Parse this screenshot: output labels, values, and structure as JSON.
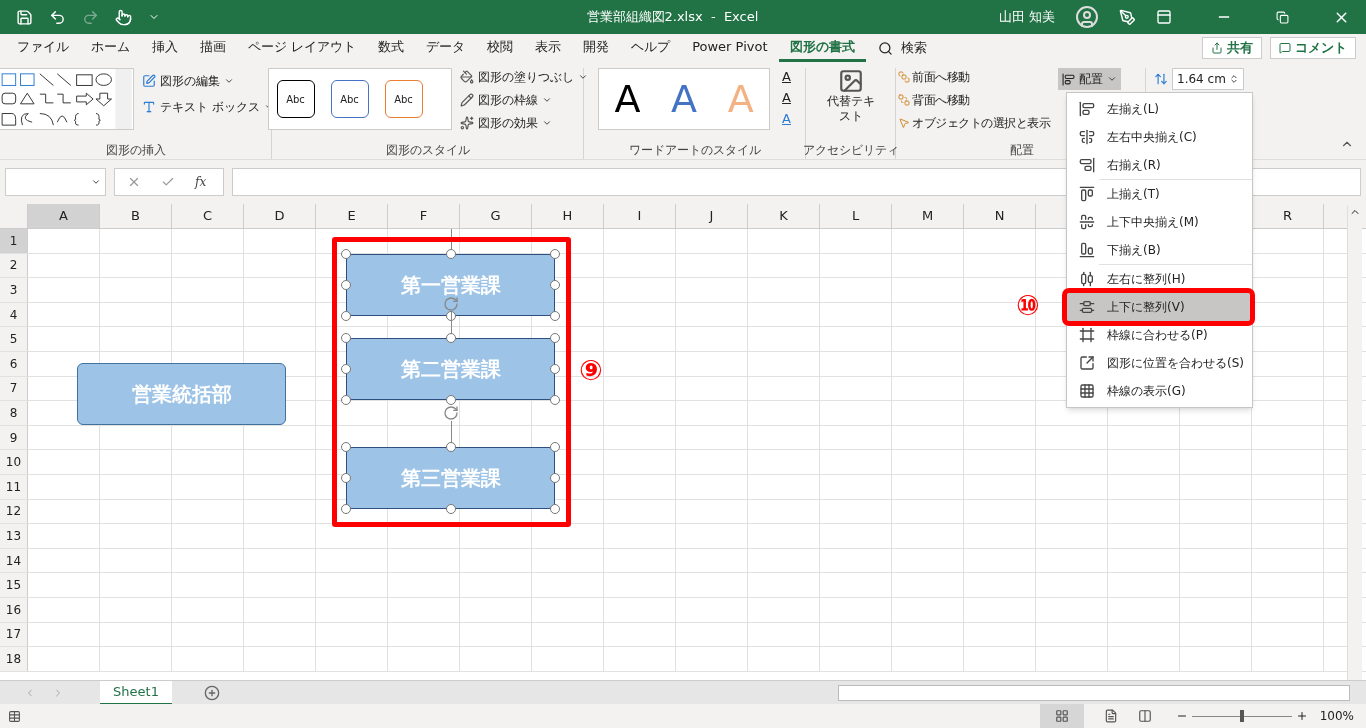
{
  "title_bar": {
    "file_title": "営業部組織図2.xlsx  -  Excel",
    "user_name": "山田 知美"
  },
  "ribbon_tabs": [
    {
      "label": "ファイル",
      "selected": false
    },
    {
      "label": "ホーム",
      "selected": false
    },
    {
      "label": "挿入",
      "selected": false
    },
    {
      "label": "描画",
      "selected": false
    },
    {
      "label": "ページ レイアウト",
      "selected": false
    },
    {
      "label": "数式",
      "selected": false
    },
    {
      "label": "データ",
      "selected": false
    },
    {
      "label": "校閲",
      "selected": false
    },
    {
      "label": "表示",
      "selected": false
    },
    {
      "label": "開発",
      "selected": false
    },
    {
      "label": "ヘルプ",
      "selected": false
    },
    {
      "label": "Power Pivot",
      "selected": false
    },
    {
      "label": "図形の書式",
      "selected": true
    }
  ],
  "search": {
    "label": "検索"
  },
  "share_button": "共有",
  "comment_button": "コメント",
  "ribbon": {
    "insert_shapes": {
      "label": "図形の挿入",
      "buttons": [
        "図形の編集",
        "テキスト ボックス"
      ]
    },
    "shape_styles": {
      "label": "図形のスタイル",
      "presets": [
        {
          "text": "Abc",
          "color": "#000000"
        },
        {
          "text": "Abc",
          "color": "#4472c4"
        },
        {
          "text": "Abc",
          "color": "#ed7d31"
        }
      ],
      "buttons": [
        "図形の塗りつぶし",
        "図形の枠線",
        "図形の効果"
      ]
    },
    "wordart_styles": {
      "label": "ワードアートのスタイル",
      "letters": [
        {
          "text": "A",
          "color": "#000000"
        },
        {
          "text": "A",
          "color": "#4472c4"
        },
        {
          "text": "A",
          "color": "#f4b183"
        }
      ],
      "format_letters": [
        "A",
        "A",
        "A"
      ]
    },
    "accessibility": {
      "label": "アクセシビリティ",
      "button": "代替テキスト"
    },
    "arrange": {
      "label": "配置",
      "buttons": [
        "前面へ移動",
        "背面へ移動",
        "オブジェクトの選択と表示"
      ],
      "align_button": "配置"
    },
    "size": {
      "height": "1.64 cm"
    }
  },
  "formula_bar": {
    "fx": "fx"
  },
  "columns": [
    "A",
    "B",
    "C",
    "D",
    "E",
    "F",
    "G",
    "H",
    "I",
    "J",
    "K",
    "L",
    "M",
    "N",
    "R"
  ],
  "rows": [
    "1",
    "2",
    "3",
    "4",
    "5",
    "6",
    "7",
    "8",
    "9",
    "10",
    "11",
    "12",
    "13",
    "14",
    "15",
    "16",
    "17",
    "18"
  ],
  "shapes": [
    {
      "text": "営業統括部",
      "selected": false
    },
    {
      "text": "第一営業課",
      "selected": true
    },
    {
      "text": "第二営業課",
      "selected": true
    },
    {
      "text": "第三営業課",
      "selected": true
    }
  ],
  "callouts": [
    "⑨",
    "⑩"
  ],
  "align_menu": {
    "groups": [
      [
        {
          "label": "左揃え(L)",
          "selected": false
        },
        {
          "label": "左右中央揃え(C)",
          "selected": false
        },
        {
          "label": "右揃え(R)",
          "selected": false
        }
      ],
      [
        {
          "label": "上揃え(T)",
          "selected": false
        },
        {
          "label": "上下中央揃え(M)",
          "selected": false
        },
        {
          "label": "下揃え(B)",
          "selected": false
        }
      ],
      [
        {
          "label": "左右に整列(H)",
          "selected": false
        },
        {
          "label": "上下に整列(V)",
          "selected": true
        },
        {
          "label": "枠線に合わせる(P)",
          "selected": false
        },
        {
          "label": "図形に位置を合わせる(S)",
          "selected": false
        },
        {
          "label": "枠線の表示(G)",
          "selected": false
        }
      ]
    ]
  },
  "sheet_tabs": [
    {
      "label": "Sheet1",
      "selected": true
    }
  ],
  "status_bar": {
    "zoom": "100%",
    "zoom_slider": {
      "level": 0.5
    }
  }
}
